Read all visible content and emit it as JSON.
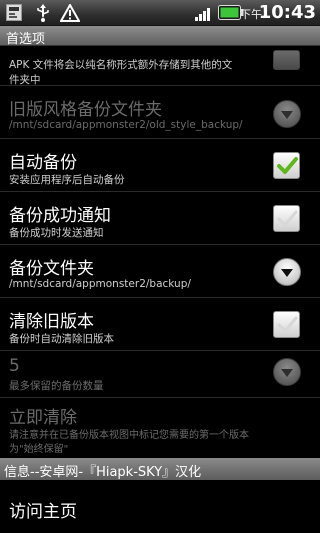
{
  "status_bar": {
    "ampm": "下午",
    "time": "10:43",
    "icons": [
      "task-icon",
      "usb-icon",
      "warning-icon",
      "signal-icon",
      "battery-icon"
    ]
  },
  "title_bar": {
    "title": "首选项"
  },
  "preferences": {
    "apk_summary_line1": "APK 文件将会以纯名称形式额外存储到其他的文",
    "apk_summary_line2": "件夹中",
    "old_style": {
      "title": "旧版风格备份文件夹",
      "summary": "/mnt/sdcard/appmonster2/old_style_backup/",
      "enabled": false
    },
    "auto_backup": {
      "title": "自动备份",
      "summary": "安装应用程序后自动备份",
      "checked": true
    },
    "backup_notify": {
      "title": "备份成功通知",
      "summary": "备份成功时发送通知",
      "checked": false
    },
    "backup_folder": {
      "title": "备份文件夹",
      "summary": "/mnt/sdcard/appmonster2/backup/"
    },
    "clear_old": {
      "title": "清除旧版本",
      "summary": "备份时自动清除旧版本",
      "checked": false
    },
    "max_backups": {
      "title": "5",
      "summary": "最多保留的备份数量",
      "enabled": false
    },
    "clear_now": {
      "title": "立即清除",
      "summary_line1": "请注意并在已备份版本视图中标记您需要的第一个版本",
      "summary_line2": "为\"始终保留\"",
      "enabled": false
    }
  },
  "info_category": {
    "label": "信息--安卓网-『Hiapk-SKY』汉化"
  },
  "visit_homepage": {
    "title": "访问主页"
  },
  "colors": {
    "check_green": "#5fb81a",
    "disabled_text": "#6b6b6b"
  }
}
